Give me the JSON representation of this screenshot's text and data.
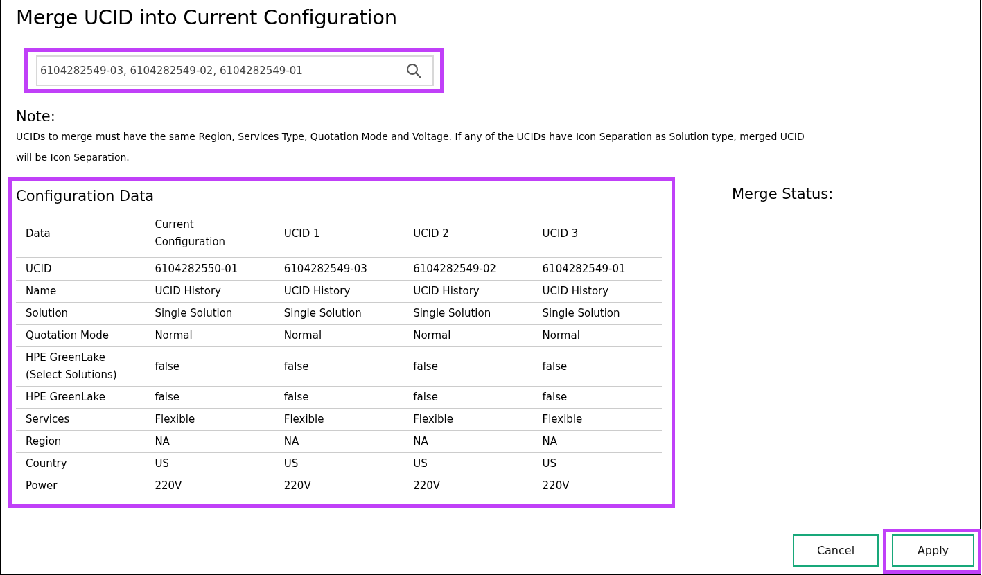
{
  "title": "Merge UCID into Current Configuration",
  "search": {
    "value": "6104282549-03, 6104282549-02, 6104282549-01",
    "highlighted": true
  },
  "note": {
    "heading": "Note:",
    "text": "UCIDs to merge must have the same Region, Services Type, Quotation Mode and Voltage. If any of the UCIDs have Icon Separation as Solution type, merged UCID will be Icon Separation."
  },
  "configuration": {
    "heading": "Configuration Data",
    "highlighted": true,
    "columns": [
      "Data",
      "Current Configuration",
      "UCID 1",
      "UCID 2",
      "UCID 3"
    ],
    "rows": [
      [
        "UCID",
        "6104282550-01",
        "6104282549-03",
        "6104282549-02",
        "6104282549-01"
      ],
      [
        "Name",
        "UCID History",
        "UCID History",
        "UCID History",
        "UCID History"
      ],
      [
        "Solution",
        "Single Solution",
        "Single Solution",
        "Single Solution",
        "Single Solution"
      ],
      [
        "Quotation Mode",
        "Normal",
        "Normal",
        "Normal",
        "Normal"
      ],
      [
        "HPE GreenLake (Select Solutions)",
        "false",
        "false",
        "false",
        "false"
      ],
      [
        "HPE GreenLake",
        "false",
        "false",
        "false",
        "false"
      ],
      [
        "Services",
        "Flexible",
        "Flexible",
        "Flexible",
        "Flexible"
      ],
      [
        "Region",
        "NA",
        "NA",
        "NA",
        "NA"
      ],
      [
        "Country",
        "US",
        "US",
        "US",
        "US"
      ],
      [
        "Power",
        "220V",
        "220V",
        "220V",
        "220V"
      ]
    ]
  },
  "merge_status": {
    "heading": "Merge Status:"
  },
  "buttons": [
    {
      "label": "Cancel",
      "highlighted": false
    },
    {
      "label": "Apply",
      "highlighted": true
    }
  ]
}
